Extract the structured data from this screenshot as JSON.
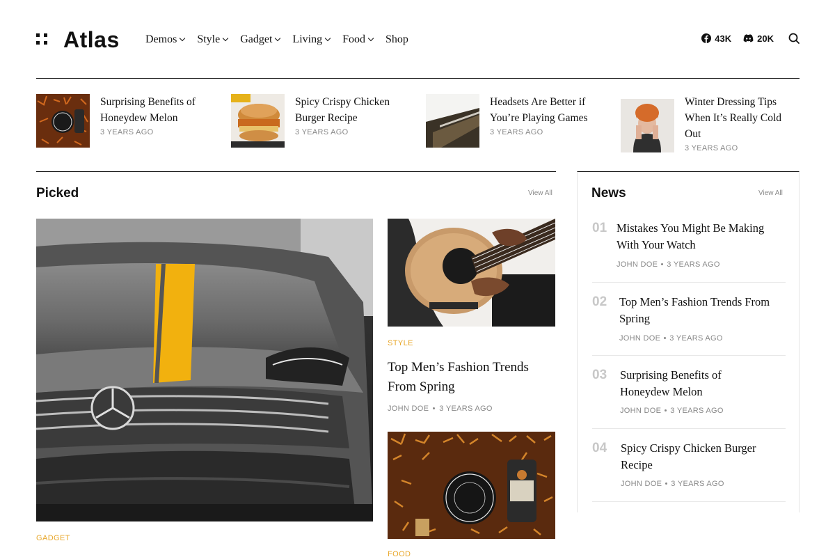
{
  "header": {
    "logo": "Atlas",
    "nav": [
      "Demos",
      "Style",
      "Gadget",
      "Living",
      "Food",
      "Shop"
    ],
    "nav_has_dropdown": [
      true,
      true,
      true,
      true,
      true,
      false
    ],
    "social": [
      {
        "icon": "facebook-icon",
        "count": "43K"
      },
      {
        "icon": "discord-icon",
        "count": "20K"
      }
    ]
  },
  "ticker": [
    {
      "title": "Surprising Benefits of Honeydew Melon",
      "time": "3 YEARS AGO"
    },
    {
      "title": "Spicy Crispy Chicken Burger Recipe",
      "time": "3 YEARS AGO"
    },
    {
      "title": "Headsets Are Better if You’re Playing Games",
      "time": "3 YEARS AGO"
    },
    {
      "title": "Winter Dressing Tips When It’s Really Cold Out",
      "time": "3 YEARS AGO"
    }
  ],
  "picked": {
    "title": "Picked",
    "view_all": "View All",
    "main_category": "GADGET",
    "card1": {
      "category": "STYLE",
      "title": "Top Men’s Fashion Trends From Spring",
      "author": "JOHN DOE",
      "time": "3 YEARS AGO"
    },
    "card2": {
      "category": "FOOD"
    }
  },
  "news": {
    "title": "News",
    "view_all": "View All",
    "items": [
      {
        "num": "01",
        "title": "Mistakes You Might Be Making With Your Watch",
        "author": "JOHN DOE",
        "time": "3 YEARS AGO"
      },
      {
        "num": "02",
        "title": "Top Men’s Fashion Trends From Spring",
        "author": "JOHN DOE",
        "time": "3 YEARS AGO"
      },
      {
        "num": "03",
        "title": "Surprising Benefits of Honeydew Melon",
        "author": "JOHN DOE",
        "time": "3 YEARS AGO"
      },
      {
        "num": "04",
        "title": "Spicy Crispy Chicken Burger Recipe",
        "author": "JOHN DOE",
        "time": "3 YEARS AGO"
      }
    ]
  },
  "colors": {
    "accent": "#e8a72a",
    "text": "#111111",
    "muted": "#888888"
  }
}
